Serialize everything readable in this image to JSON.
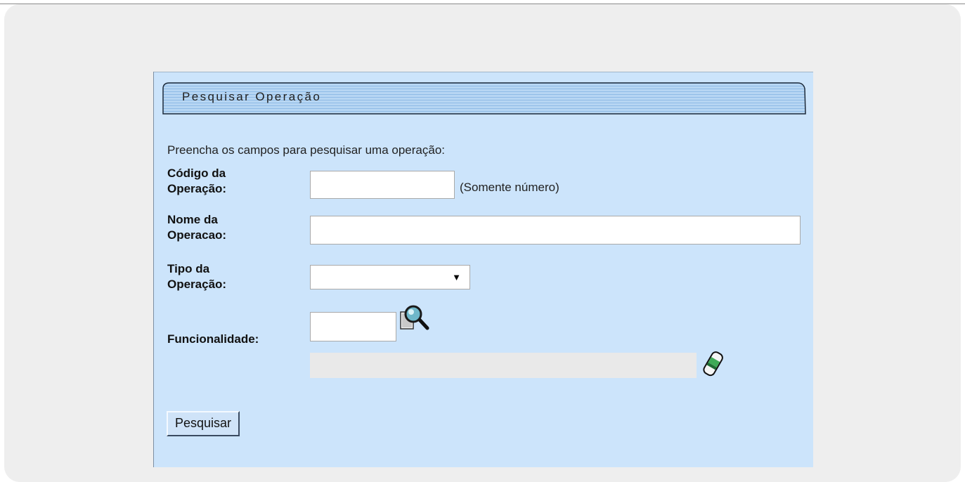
{
  "panel": {
    "title": "Pesquisar Operação",
    "instruction": "Preencha os campos para pesquisar uma operação:"
  },
  "fields": {
    "codigo": {
      "label_line1": "Código da",
      "label_line2": "Operação:",
      "value": "",
      "hint": "(Somente número)"
    },
    "nome": {
      "label_line1": "Nome da",
      "label_line2": "Operacao:",
      "value": ""
    },
    "tipo": {
      "label_line1": "Tipo da",
      "label_line2": "Operação:",
      "selected": "",
      "arrow": "▼"
    },
    "funcionalidade": {
      "label": "Funcionalidade:",
      "code_value": "",
      "description_value": ""
    }
  },
  "icons": {
    "lookup": "magnifier-lookup-icon",
    "clear": "eraser-icon"
  },
  "buttons": {
    "search_label": "Pesquisar"
  },
  "colors": {
    "panel_bg": "#cce4fb",
    "outer_bg": "#eeeeee",
    "title_bar_fill": "#a9cdf0"
  }
}
